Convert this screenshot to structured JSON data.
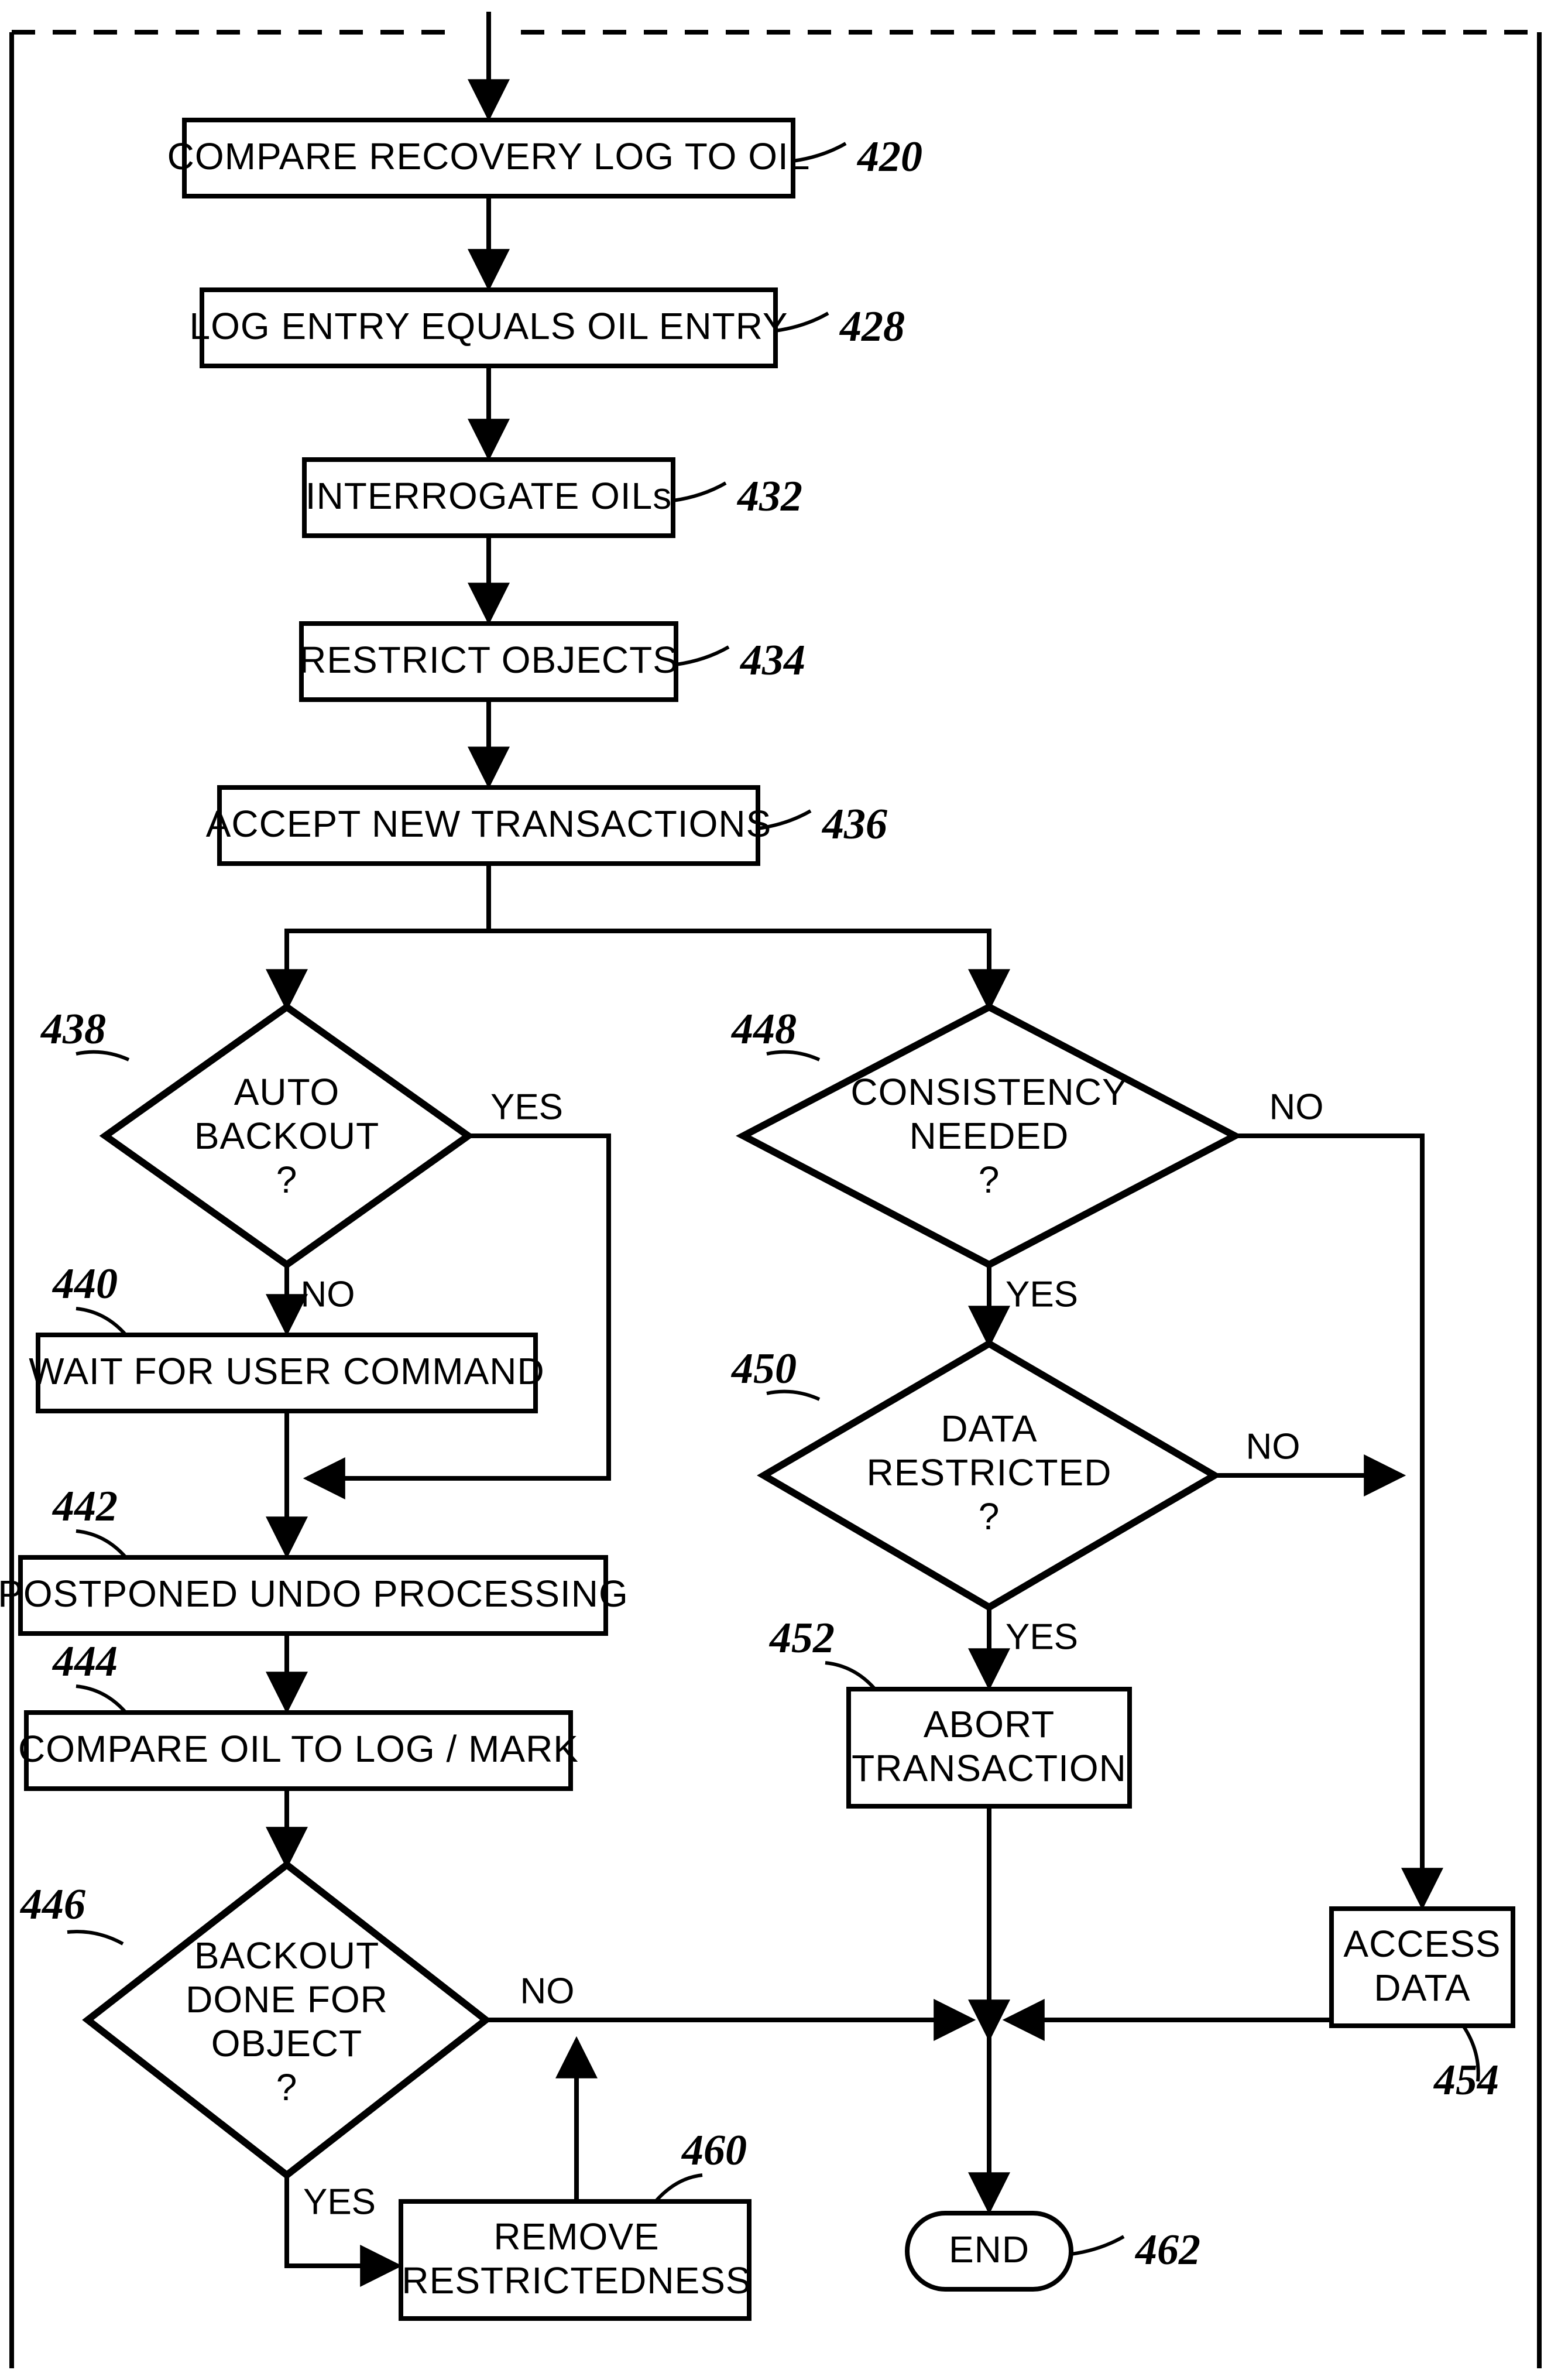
{
  "nodes": {
    "n420": {
      "text": [
        "COMPARE RECOVERY LOG TO OIL"
      ],
      "ref": "420"
    },
    "n428": {
      "text": [
        "LOG ENTRY EQUALS OIL ENTRY"
      ],
      "ref": "428"
    },
    "n432": {
      "text": [
        "INTERROGATE OILs"
      ],
      "ref": "432"
    },
    "n434": {
      "text": [
        "RESTRICT OBJECTS"
      ],
      "ref": "434"
    },
    "n436": {
      "text": [
        "ACCEPT NEW TRANSACTIONS"
      ],
      "ref": "436"
    },
    "n438": {
      "text": [
        "AUTO",
        "BACKOUT",
        "?"
      ],
      "ref": "438"
    },
    "n440": {
      "text": [
        "WAIT FOR USER COMMAND"
      ],
      "ref": "440"
    },
    "n442": {
      "text": [
        "POSTPONED UNDO PROCESSING"
      ],
      "ref": "442"
    },
    "n444": {
      "text": [
        "COMPARE OIL TO LOG / MARK"
      ],
      "ref": "444"
    },
    "n446": {
      "text": [
        "BACKOUT",
        "DONE FOR",
        "OBJECT",
        "?"
      ],
      "ref": "446"
    },
    "n448": {
      "text": [
        "CONSISTENCY",
        "NEEDED",
        "?"
      ],
      "ref": "448"
    },
    "n450": {
      "text": [
        "DATA",
        "RESTRICTED",
        "?"
      ],
      "ref": "450"
    },
    "n452": {
      "text": [
        "ABORT",
        "TRANSACTION"
      ],
      "ref": "452"
    },
    "n454": {
      "text": [
        "ACCESS",
        "DATA"
      ],
      "ref": "454"
    },
    "n460": {
      "text": [
        "REMOVE",
        "RESTRICTEDNESS"
      ],
      "ref": "460"
    },
    "n462": {
      "text": [
        "END"
      ],
      "ref": "462"
    }
  },
  "edges": {
    "yes": "YES",
    "no": "NO"
  }
}
